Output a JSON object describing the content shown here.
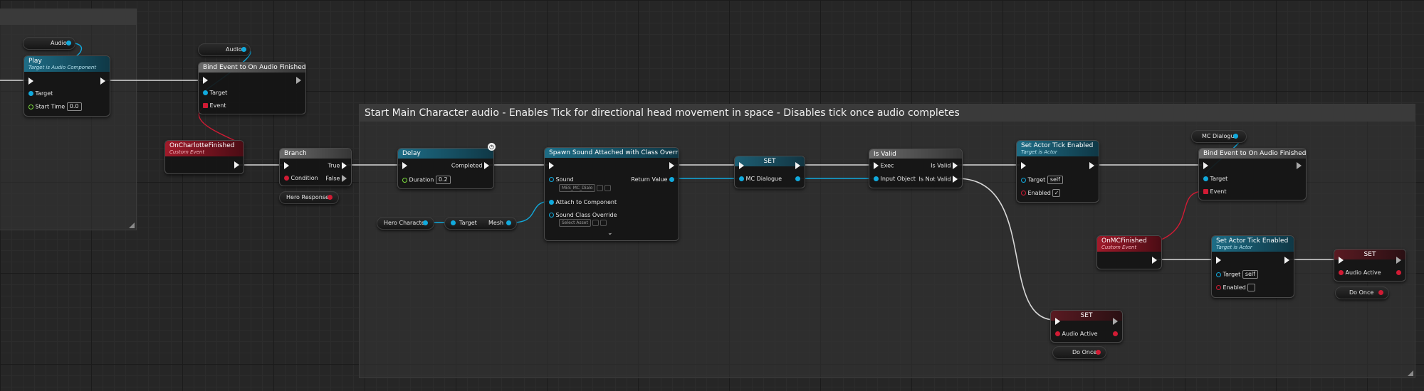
{
  "comments": [
    {
      "title": ""
    },
    {
      "title": "Start Main Character audio - Enables Tick for directional head movement in space - Disables tick once audio completes"
    }
  ],
  "nodes": {
    "audio_var_1": {
      "label": "Audio"
    },
    "audio_var_2": {
      "label": "Audio"
    },
    "play": {
      "title": "Play",
      "subtitle": "Target is Audio Component",
      "target": "Target",
      "start_time_label": "Start Time",
      "start_time_value": "0.0"
    },
    "bind_audio": {
      "title": "Bind Event to On Audio Finished",
      "target": "Target",
      "event": "Event"
    },
    "on_charlotte": {
      "title": "OnCharlotteFinished",
      "subtitle": "Custom Event"
    },
    "branch": {
      "title": "Branch",
      "condition": "Condition",
      "true_label": "True",
      "false_label": "False"
    },
    "hero_response": {
      "label": "Hero Response"
    },
    "delay": {
      "title": "Delay",
      "completed": "Completed",
      "duration_label": "Duration",
      "duration_value": "0.2"
    },
    "hero_character": {
      "label": "Hero Character"
    },
    "get_mesh": {
      "target": "Target",
      "mesh": "Mesh"
    },
    "spawn": {
      "title": "Spawn Sound Attached with Class Override",
      "sound": "Sound",
      "sound_value": "MES_MC_Dialo",
      "return_value": "Return Value",
      "attach": "Attach to Component",
      "sound_class": "Sound Class Override",
      "sound_class_value": "Select Asset"
    },
    "set_mc": {
      "title": "SET",
      "pin": "MC Dialogue"
    },
    "is_valid": {
      "title": "Is Valid",
      "exec": "Exec",
      "is_valid": "Is Valid",
      "input": "Input Object",
      "is_not_valid": "Is Not Valid"
    },
    "tick1": {
      "title": "Set Actor Tick Enabled",
      "subtitle": "Target is Actor",
      "target": "Target",
      "target_value": "self",
      "enabled": "Enabled",
      "enabled_value": "✓"
    },
    "mc_dialogue_var": {
      "label": "MC Dialogue"
    },
    "bind_mc": {
      "title": "Bind Event to On Audio Finished",
      "target": "Target",
      "event": "Event"
    },
    "on_mc": {
      "title": "OnMCFinished",
      "subtitle": "Custom Event"
    },
    "tick2": {
      "title": "Set Actor Tick Enabled",
      "subtitle": "Target is Actor",
      "target": "Target",
      "target_value": "self",
      "enabled": "Enabled",
      "enabled_value": ""
    },
    "set_active_2": {
      "title": "SET",
      "pin": "Audio Active"
    },
    "do_once_2": {
      "label": "Do Once"
    },
    "set_active_1": {
      "title": "SET",
      "pin": "Audio Active"
    },
    "do_once_1": {
      "label": "Do Once"
    }
  },
  "colors": {
    "exec": "#f2f2f2",
    "object": "#11aadd",
    "bool": "#d11b34",
    "float": "#7bdc3c",
    "event_header": "#a01a2a",
    "function_header": "#1e6d86"
  }
}
